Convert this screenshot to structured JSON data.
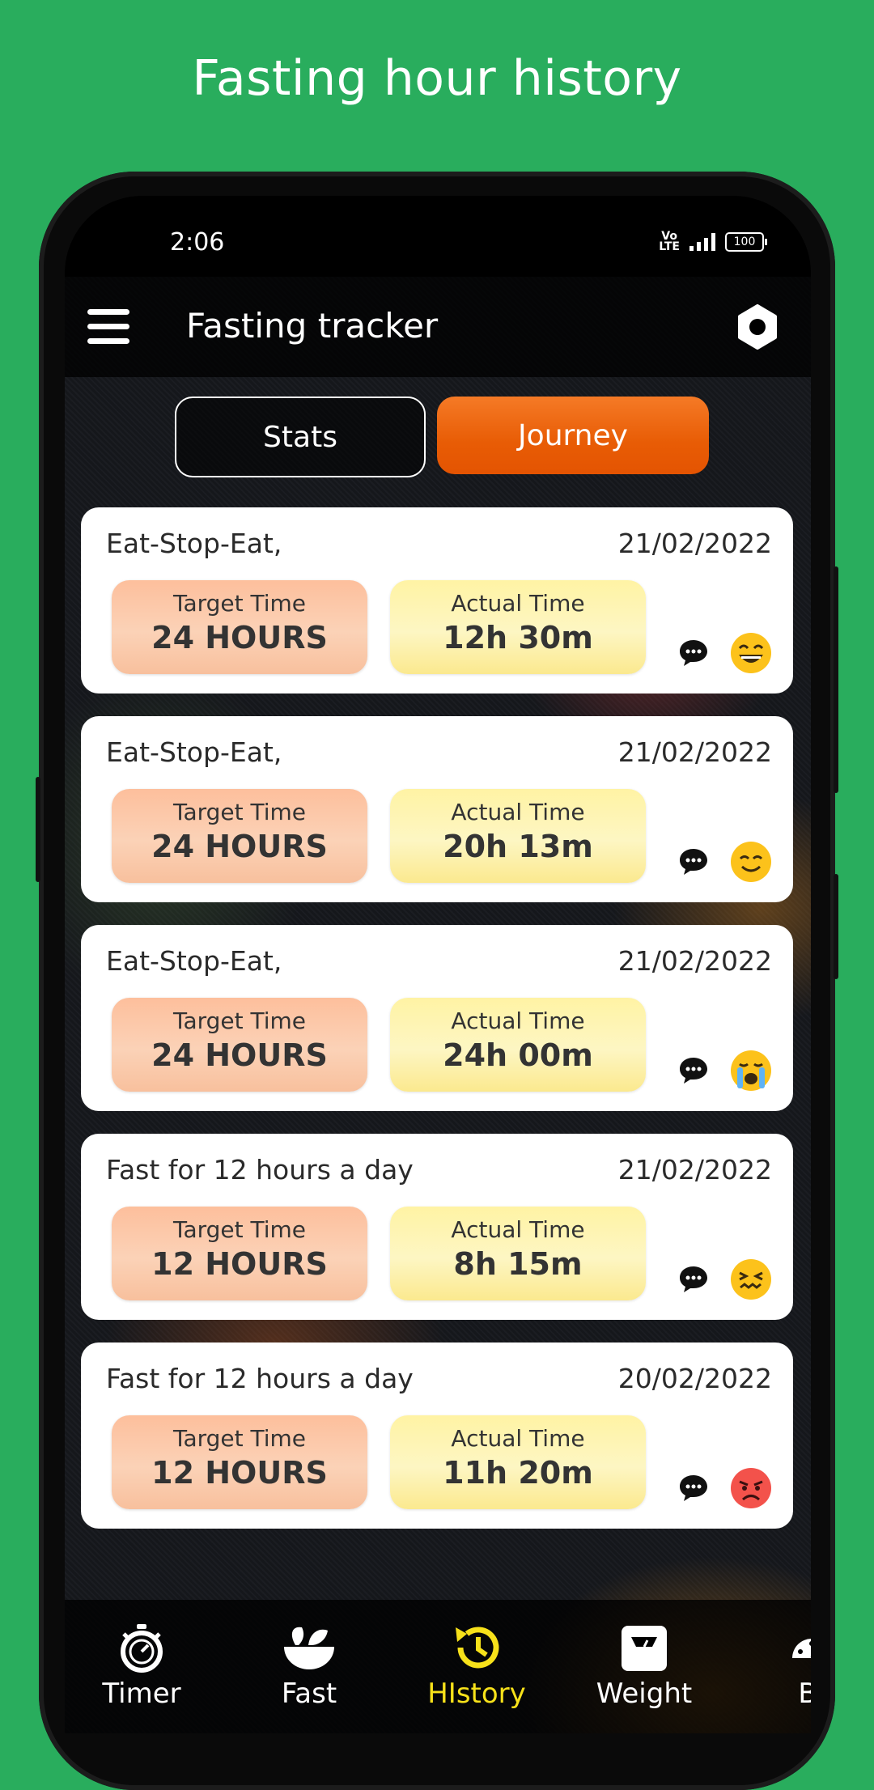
{
  "headline": "Fasting hour history",
  "status": {
    "time": "2:06",
    "network_badge_top": "Vo",
    "network_badge_bottom": "LTE",
    "battery": "100"
  },
  "appbar": {
    "title": "Fasting tracker"
  },
  "tabs": [
    {
      "label": "Stats",
      "active": false
    },
    {
      "label": "Journey",
      "active": true
    }
  ],
  "labels": {
    "target": "Target Time",
    "actual": "Actual Time"
  },
  "entries": [
    {
      "plan": "Eat-Stop-Eat,",
      "date": "21/02/2022",
      "target": "24 HOURS",
      "actual": "12h 30m",
      "mood": "laughing"
    },
    {
      "plan": "Eat-Stop-Eat,",
      "date": "21/02/2022",
      "target": "24 HOURS",
      "actual": "20h 13m",
      "mood": "smiling"
    },
    {
      "plan": "Eat-Stop-Eat,",
      "date": "21/02/2022",
      "target": "24 HOURS",
      "actual": "24h 00m",
      "mood": "crying"
    },
    {
      "plan": "Fast for 12 hours a day",
      "date": "21/02/2022",
      "target": "12 HOURS",
      "actual": "8h 15m",
      "mood": "confounded"
    },
    {
      "plan": "Fast for 12 hours a day",
      "date": "20/02/2022",
      "target": "12 HOURS",
      "actual": "11h 20m",
      "mood": "angry"
    }
  ],
  "nav": [
    {
      "label": "Timer",
      "icon": "stopwatch-icon"
    },
    {
      "label": "Fast",
      "icon": "salad-bowl-icon"
    },
    {
      "label": "HIstory",
      "icon": "history-icon",
      "active": true
    },
    {
      "label": "Weight",
      "icon": "scale-icon"
    },
    {
      "label": "BI",
      "icon": "gauge-icon"
    }
  ],
  "colors": {
    "background": "#29ad5d",
    "accent": "#e85c05",
    "active_nav": "#f7e11a"
  }
}
